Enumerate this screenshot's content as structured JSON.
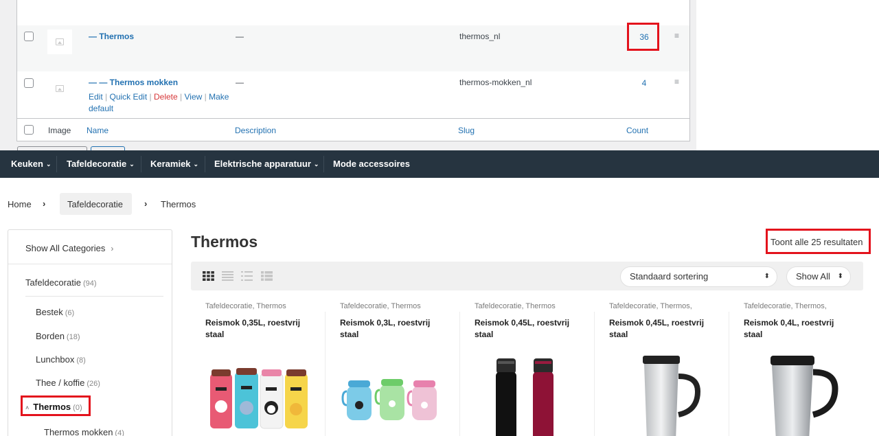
{
  "admin": {
    "rows": [
      {
        "name": "— Thermos",
        "description": "—",
        "slug": "thermos_nl",
        "count": "36",
        "handle": "≡"
      },
      {
        "name": "— — Thermos mokken",
        "description": "—",
        "slug": "thermos-mokken_nl",
        "count": "4",
        "handle": "≡",
        "actions": {
          "edit": "Edit",
          "quick_edit": "Quick Edit",
          "delete": "Delete",
          "view": "View",
          "make_default": "Make default",
          "sep": "|"
        }
      }
    ],
    "footer": {
      "image": "Image",
      "name": "Name",
      "description": "Description",
      "slug": "Slug",
      "count": "Count"
    }
  },
  "nav": {
    "items": [
      {
        "label": "Keuken",
        "chevron": "⌄"
      },
      {
        "label": "Tafeldecoratie",
        "chevron": "⌄"
      },
      {
        "label": "Keramiek",
        "chevron": "⌄"
      },
      {
        "label": "Elektrische apparatuur",
        "chevron": "⌄"
      },
      {
        "label": "Mode accessoires",
        "chevron": ""
      }
    ]
  },
  "breadcrumb": {
    "home": "Home",
    "parent": "Tafeldecoratie",
    "current": "Thermos",
    "sep": "›"
  },
  "sidebar": {
    "show_all": "Show All Categories",
    "show_all_arrow": "›",
    "parent": {
      "label": "Tafeldecoratie",
      "count": "(94)"
    },
    "items": [
      {
        "label": "Bestek",
        "count": "(6)"
      },
      {
        "label": "Borden",
        "count": "(18)"
      },
      {
        "label": "Lunchbox",
        "count": "(8)"
      },
      {
        "label": "Thee / koffie",
        "count": "(26)"
      },
      {
        "label": "Thermos",
        "count": "(0)",
        "caret": "˄"
      },
      {
        "label": "Thermos mokken",
        "count": "(4)"
      }
    ]
  },
  "main": {
    "title": "Thermos",
    "results": "Toont alle 25 resultaten",
    "sort": {
      "value": "Standaard sortering",
      "arrow": "⬍"
    },
    "show": {
      "value": "Show All",
      "arrow": "⬍"
    }
  },
  "products": [
    {
      "cats": "Tafeldecoratie, Thermos",
      "title": "Reismok 0,35L, roestvrij staal"
    },
    {
      "cats": "Tafeldecoratie, Thermos",
      "title": "Reismok 0,3L, roestvrij staal"
    },
    {
      "cats": "Tafeldecoratie, Thermos",
      "title": "Reismok 0,45L, roestvrij staal"
    },
    {
      "cats": "Tafeldecoratie, Thermos,",
      "title": "Reismok 0,45L, roestvrij staal"
    },
    {
      "cats": "Tafeldecoratie, Thermos,",
      "title": "Reismok 0,4L, roestvrij staal"
    }
  ],
  "colors": {
    "nav_bg": "#263440",
    "link": "#2271b1",
    "delete": "#d63638",
    "highlight": "#e3121c"
  }
}
